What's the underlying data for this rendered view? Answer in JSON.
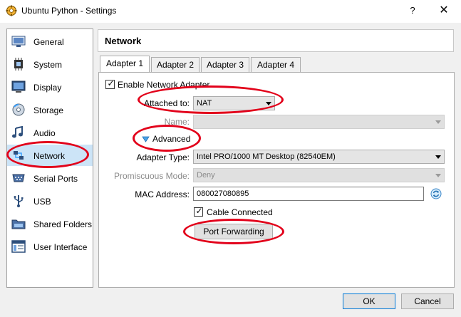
{
  "window": {
    "title": "Ubuntu Python - Settings",
    "help_label": "?",
    "close_label": "✕"
  },
  "sidebar": {
    "items": [
      {
        "label": "General",
        "icon": "general-icon"
      },
      {
        "label": "System",
        "icon": "system-icon"
      },
      {
        "label": "Display",
        "icon": "display-icon"
      },
      {
        "label": "Storage",
        "icon": "storage-icon"
      },
      {
        "label": "Audio",
        "icon": "audio-icon"
      },
      {
        "label": "Network",
        "icon": "network-icon",
        "selected": true
      },
      {
        "label": "Serial Ports",
        "icon": "serial-ports-icon"
      },
      {
        "label": "USB",
        "icon": "usb-icon"
      },
      {
        "label": "Shared Folders",
        "icon": "shared-folders-icon"
      },
      {
        "label": "User Interface",
        "icon": "user-interface-icon"
      }
    ]
  },
  "panel": {
    "title": "Network"
  },
  "tabs": [
    {
      "label": "Adapter 1",
      "active": true
    },
    {
      "label": "Adapter 2"
    },
    {
      "label": "Adapter 3"
    },
    {
      "label": "Adapter 4"
    }
  ],
  "adapter": {
    "enable_label": "Enable Network Adapter",
    "enable_checked": true,
    "attached_label": "Attached to:",
    "attached_value": "NAT",
    "name_label": "Name:",
    "name_value": "",
    "advanced_label": "Advanced",
    "adapter_type_label": "Adapter Type:",
    "adapter_type_value": "Intel PRO/1000 MT Desktop (82540EM)",
    "promiscuous_label": "Promiscuous Mode:",
    "promiscuous_value": "Deny",
    "mac_label": "MAC Address:",
    "mac_value": "080027080895",
    "cable_label": "Cable Connected",
    "cable_checked": true,
    "port_forwarding_label": "Port Forwarding"
  },
  "footer": {
    "ok_label": "OK",
    "cancel_label": "Cancel"
  },
  "colors": {
    "annotation_red": "#e2001a",
    "selection": "#cce4f7",
    "accent_blue": "#0078d7"
  }
}
